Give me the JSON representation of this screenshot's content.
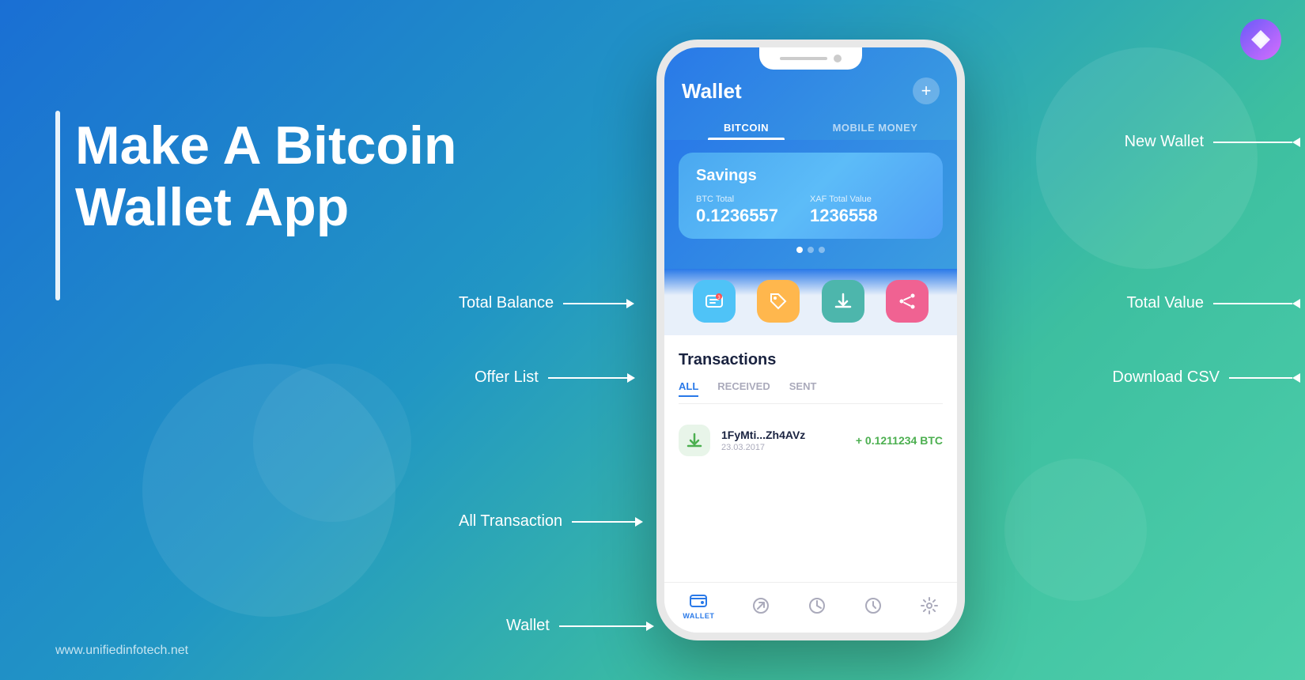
{
  "background": {
    "gradient_start": "#1a6fd4",
    "gradient_end": "#4ecfaa"
  },
  "logo": {
    "symbol": "⚡",
    "aria": "Unified Infotech Logo"
  },
  "left_panel": {
    "accent_bar": true,
    "heading": "Make A Bitcoin Wallet App",
    "website": "www.unifiedinfotech.net"
  },
  "phone": {
    "header": {
      "title": "Wallet",
      "add_button_label": "+",
      "tabs": [
        {
          "label": "BITCOIN",
          "active": true
        },
        {
          "label": "MOBILE MONEY",
          "active": false
        }
      ]
    },
    "wallet_card": {
      "name": "Savings",
      "btc_label": "BTC Total",
      "btc_value": "0.1236557",
      "xaf_label": "XAF Total Value",
      "xaf_value": "1236558"
    },
    "action_buttons": [
      {
        "icon": "🛒",
        "color": "blue",
        "label": "offer-list"
      },
      {
        "icon": "🏷️",
        "color": "orange",
        "label": "tag"
      },
      {
        "icon": "⬇️",
        "color": "teal",
        "label": "download-csv"
      },
      {
        "icon": "📤",
        "color": "pink",
        "label": "share"
      }
    ],
    "transactions": {
      "title": "Transactions",
      "tabs": [
        {
          "label": "ALL",
          "active": true
        },
        {
          "label": "RECEIVED",
          "active": false
        },
        {
          "label": "SENT",
          "active": false
        }
      ],
      "items": [
        {
          "address": "1FyMti...Zh4AVz",
          "date": "23.03.2017",
          "amount": "+ 0.1211234 BTC",
          "icon": "⬇️",
          "color": "green"
        }
      ]
    },
    "bottom_nav": [
      {
        "icon": "👛",
        "label": "WALLET",
        "active": true
      },
      {
        "icon": "↗️",
        "label": "",
        "active": false
      },
      {
        "icon": "📊",
        "label": "",
        "active": false
      },
      {
        "icon": "⏱️",
        "label": "",
        "active": false
      },
      {
        "icon": "⚙️",
        "label": "",
        "active": false
      }
    ]
  },
  "annotations": [
    {
      "id": "new-wallet",
      "text": "New Wallet",
      "direction": "left",
      "target": "add-button"
    },
    {
      "id": "total-balance",
      "text": "Total Balance",
      "direction": "right",
      "target": "btc-value"
    },
    {
      "id": "total-value",
      "text": "Total Value",
      "direction": "left",
      "target": "xaf-value"
    },
    {
      "id": "offer-list",
      "text": "Offer List",
      "direction": "right",
      "target": "offer-btn"
    },
    {
      "id": "download-csv",
      "text": "Download CSV",
      "direction": "left",
      "target": "download-btn"
    },
    {
      "id": "all-transaction",
      "text": "All Transaction",
      "direction": "right",
      "target": "tx-tabs"
    },
    {
      "id": "wallet-nav",
      "text": "Wallet",
      "direction": "right",
      "target": "bottom-nav"
    }
  ]
}
